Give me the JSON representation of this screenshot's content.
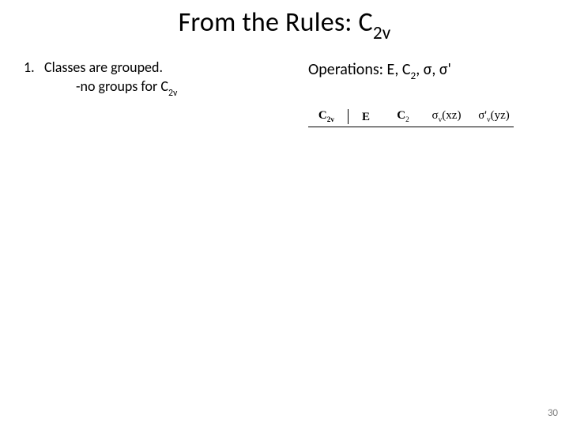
{
  "title": {
    "pre": "From the Rules: C",
    "sub": "2v"
  },
  "left": {
    "num": "1.",
    "line1": "Classes are grouped.",
    "line2_pre": "-no groups for C",
    "line2_sub": "2v"
  },
  "right": {
    "ops_pre": "Operations: E, C",
    "ops_sub": "2",
    "ops_post": ", σ, σ'"
  },
  "table": {
    "head_pre": "C",
    "head_sub": "2v",
    "e": "E",
    "c2_pre": "C",
    "c2_sub": "2",
    "sv_sym": "σ",
    "sv_sub": "v",
    "sv_par": "(xz)",
    "svp_sym": "σ'",
    "svp_sub": "v",
    "svp_par": "(yz)"
  },
  "page": "30"
}
